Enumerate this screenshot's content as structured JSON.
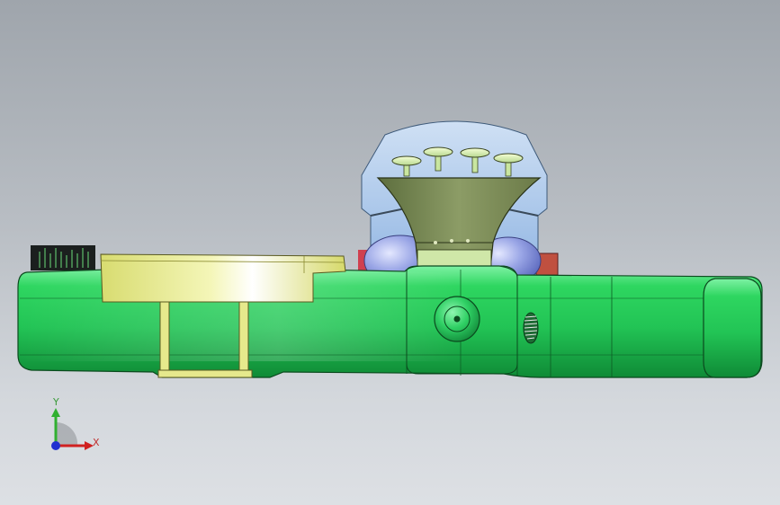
{
  "viewport": {
    "background_top": "#9fa5ac",
    "background_bottom": "#dde0e4"
  },
  "triad": {
    "x_label": "X",
    "y_label": "Y",
    "x_color": "#d02020",
    "y_color": "#30b030",
    "z_color": "#2030d0"
  },
  "model": {
    "body_color": "#22c455",
    "bracket_color": "#eef0a0",
    "hood_color": "#b7d2ef",
    "nozzle_color": "#7f8f58",
    "knob_color": "#2fd064",
    "dome_color": "#9aa6e6",
    "accent_color": "#d04050"
  }
}
